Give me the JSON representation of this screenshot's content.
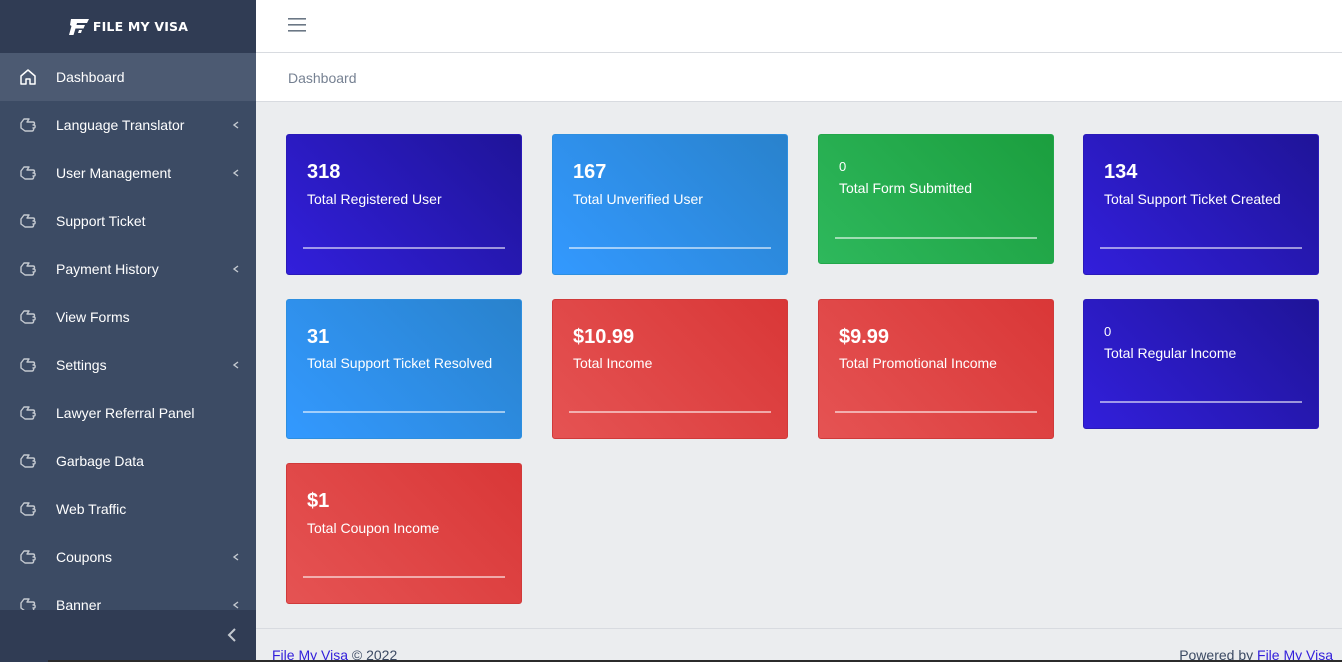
{
  "brand": {
    "name": "FILE MY VISA"
  },
  "sidebar": {
    "items": [
      {
        "label": "Dashboard",
        "icon": "home-icon",
        "active": true,
        "has_submenu": false
      },
      {
        "label": "Language Translator",
        "icon": "hand-icon",
        "has_submenu": true
      },
      {
        "label": "User Management",
        "icon": "hand-icon",
        "has_submenu": true
      },
      {
        "label": "Support Ticket",
        "icon": "hand-icon",
        "has_submenu": false
      },
      {
        "label": "Payment History",
        "icon": "hand-icon",
        "has_submenu": true
      },
      {
        "label": "View Forms",
        "icon": "hand-icon",
        "has_submenu": false
      },
      {
        "label": "Settings",
        "icon": "hand-icon",
        "has_submenu": true
      },
      {
        "label": "Lawyer Referral Panel",
        "icon": "hand-icon",
        "has_submenu": false
      },
      {
        "label": "Garbage Data",
        "icon": "hand-icon",
        "has_submenu": false
      },
      {
        "label": "Web Traffic",
        "icon": "hand-icon",
        "has_submenu": false
      },
      {
        "label": "Coupons",
        "icon": "hand-icon",
        "has_submenu": true
      },
      {
        "label": "Banner",
        "icon": "hand-icon",
        "has_submenu": true
      }
    ],
    "toggler_icon": "chevron-left-icon"
  },
  "header": {
    "menu_icon": "hamburger-icon"
  },
  "breadcrumb": {
    "current": "Dashboard"
  },
  "cards": [
    {
      "value": "318",
      "label": "Total Registered User",
      "color": "#321fdb"
    },
    {
      "value": "167",
      "label": "Total Unverified User",
      "color": "#3399ff"
    },
    {
      "value": "0",
      "label": "Total Form Submitted",
      "color": "#2eb85c"
    },
    {
      "value": "134",
      "label": "Total Support Ticket Created",
      "color": "#321fdb"
    },
    {
      "value": "31",
      "label": "Total Support Ticket Resolved",
      "color": "#3399ff"
    },
    {
      "value": "$10.99",
      "label": "Total Income",
      "color": "#e55353"
    },
    {
      "value": "$9.99",
      "label": "Total Promotional Income",
      "color": "#e55353"
    },
    {
      "value": "0",
      "label": "Total Regular Income",
      "color": "#321fdb"
    },
    {
      "value": "$1",
      "label": "Total Coupon Income",
      "color": "#e55353"
    }
  ],
  "footer": {
    "left_link": "File My Visa",
    "left_text": "© 2022",
    "right_text": "Powered by",
    "right_link": "File My Visa"
  }
}
